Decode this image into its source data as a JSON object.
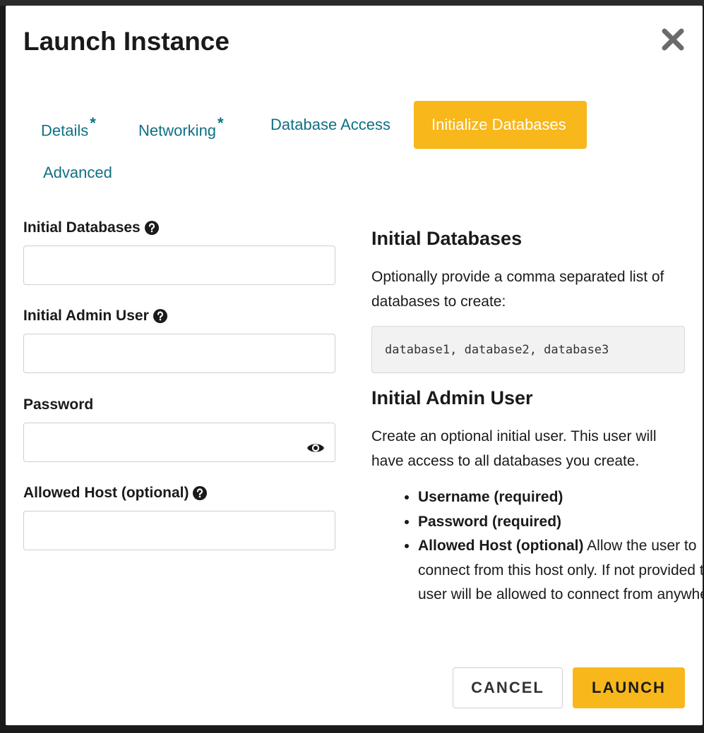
{
  "modal": {
    "title": "Launch Instance"
  },
  "tabs": [
    {
      "label": "Details",
      "required": "*"
    },
    {
      "label": "Networking",
      "required": "*"
    },
    {
      "label": "Database Access"
    },
    {
      "label": "Initialize Databases",
      "active": true
    },
    {
      "label": "Advanced"
    }
  ],
  "form": {
    "initial_databases": {
      "label": "Initial Databases",
      "value": ""
    },
    "initial_admin_user": {
      "label": "Initial Admin User",
      "value": ""
    },
    "password": {
      "label": "Password",
      "value": ""
    },
    "allowed_host": {
      "label": "Allowed Host (optional)",
      "value": ""
    }
  },
  "help": {
    "db_heading": "Initial Databases",
    "db_text": "Optionally provide a comma separated list of databases to create:",
    "db_example": "database1, database2, database3",
    "user_heading": "Initial Admin User",
    "user_text": "Create an optional initial user. This user will have access to all databases you create.",
    "bullets": [
      {
        "bold": "Username (required)",
        "text": ""
      },
      {
        "bold": "Password (required)",
        "text": ""
      },
      {
        "bold": "Allowed Host (optional)",
        "text": " Allow the user to connect from this host only. If not provided this user will be allowed to connect from anywhere."
      }
    ]
  },
  "buttons": {
    "cancel": "CANCEL",
    "launch": "LAUNCH"
  },
  "colors": {
    "accent": "#f8b71b",
    "tab_text": "#0f7083"
  },
  "icons": {
    "close": "close-icon",
    "help": "question-circle-icon",
    "password_toggle": "eye-icon"
  }
}
